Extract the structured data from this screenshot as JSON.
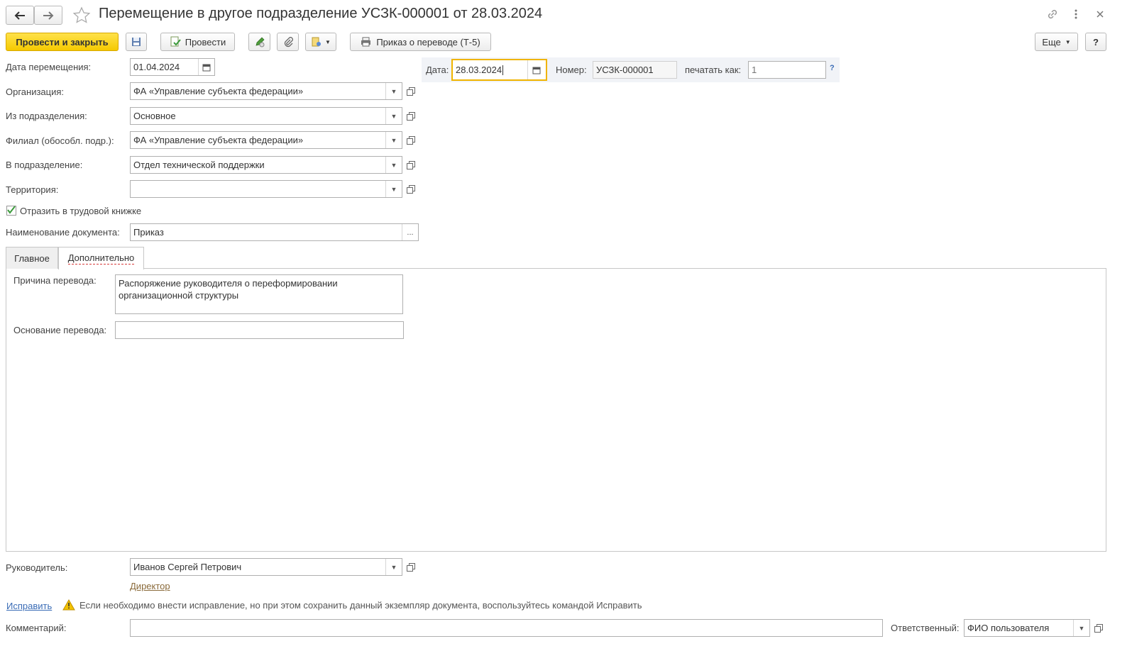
{
  "window": {
    "title": "Перемещение в другое подразделение УСЗК-000001 от 28.03.2024",
    "back_icon": "arrow-left-icon",
    "forward_icon": "arrow-right-icon",
    "favorite_icon": "star-icon",
    "link_icon": "link-icon",
    "menu_icon": "more-vertical-icon",
    "close_icon": "close-icon"
  },
  "toolbar": {
    "post_close_label": "Провести и закрыть",
    "post_label": "Провести",
    "print_order_label": "Приказ о переводе (Т-5)",
    "more_label": "Еще",
    "help_label": "?"
  },
  "header": {
    "date_label": "Дата:",
    "date_value": "28.03.2024",
    "number_label": "Номер:",
    "number_value": "УСЗК-000001",
    "print_as_label": "печатать как:",
    "print_as_placeholder": "1",
    "hint": "?"
  },
  "form": {
    "move_date_label": "Дата перемещения:",
    "move_date_value": "01.04.2024",
    "org_label": "Организация:",
    "org_value": "ФА «Управление субъекта федерации»",
    "from_dept_label": "Из подразделения:",
    "from_dept_value": "Основное",
    "branch_label": "Филиал (обособл. подр.):",
    "branch_value": "ФА «Управление субъекта федерации»",
    "to_dept_label": "В подразделение:",
    "to_dept_value": "Отдел технической поддержки",
    "territory_label": "Территория:",
    "territory_value": "",
    "workbook_label": "Отразить в трудовой книжке",
    "workbook_checked": true,
    "doc_name_label": "Наименование документа:",
    "doc_name_value": "Приказ",
    "doc_name_btn": "..."
  },
  "tabs": [
    {
      "label": "Главное",
      "active": false
    },
    {
      "label": "Дополнительно",
      "active": true
    }
  ],
  "tab_content": {
    "reason_label": "Причина перевода:",
    "reason_value": "Распоряжение руководителя о переформировании организационной структуры",
    "basis_label": "Основание перевода:",
    "basis_value": ""
  },
  "footer": {
    "manager_label": "Руководитель:",
    "manager_value": "Иванов Сергей Петрович",
    "manager_position": "Директор",
    "fix_link": "Исправить",
    "warning_text": "Если необходимо внести исправление, но при этом сохранить данный экземпляр документа, воспользуйтесь командой Исправить",
    "comment_label": "Комментарий:",
    "comment_value": "",
    "responsible_label": "Ответственный:",
    "responsible_value": "ФИО пользователя"
  },
  "colors": {
    "primary_button": "#f5c900",
    "focus_border": "#f0b400",
    "link": "#3a6cb6",
    "checkbox": "#3a9a3a",
    "warning": "#e0b000"
  }
}
